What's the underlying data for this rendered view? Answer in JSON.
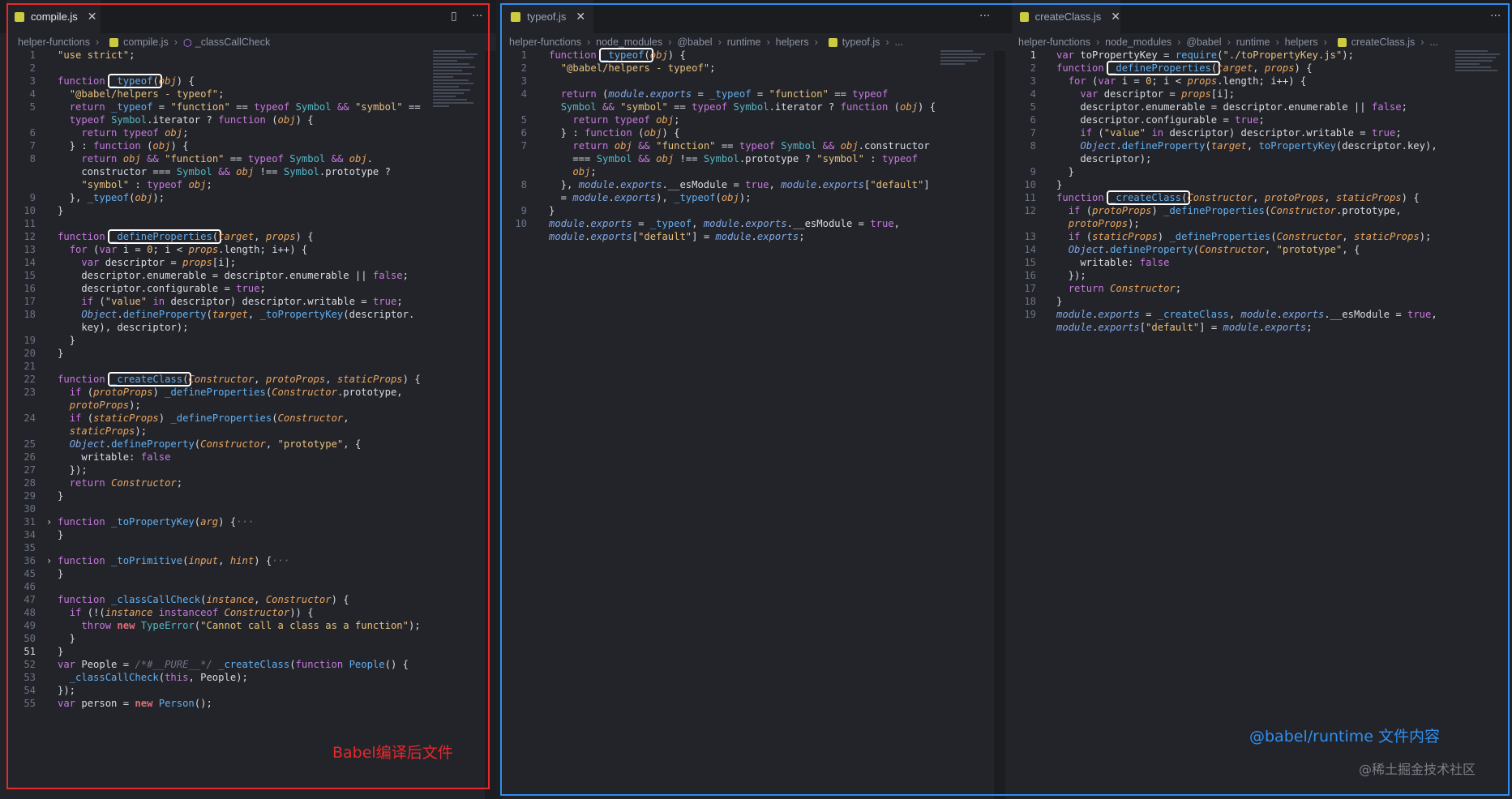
{
  "pane1": {
    "tab": "compile.js",
    "close": "✕",
    "split_icon": "▯",
    "more_icon": "···",
    "crumbs": [
      "helper-functions",
      "compile.js",
      "_classCallCheck"
    ],
    "lines": [
      {
        "n": "1",
        "h": "<span class=\"s\">\"use strict\"</span>;"
      },
      {
        "n": "2",
        "h": ""
      },
      {
        "n": "3",
        "h": "<span class=\"k\">function</span> <span class=\"hb\"><span class=\"f\">_typeof</span>(</span><span class=\"p\">obj</span>) {"
      },
      {
        "n": "4",
        "h": "  <span class=\"s\">\"@babel/helpers - typeof\"</span>;"
      },
      {
        "n": "5",
        "h": "  <span class=\"k\">return</span> <span class=\"f\">_typeof</span> = <span class=\"s\">\"function\"</span> == <span class=\"k\">typeof</span> <span class=\"ty\">Symbol</span> <span class=\"k\">&amp;&amp;</span> <span class=\"s\">\"symbol\"</span> =="
      },
      {
        "n": "",
        "h": "  <span class=\"k\">typeof</span> <span class=\"ty\">Symbol</span>.iterator ? <span class=\"k\">function</span> (<span class=\"p\">obj</span>) {"
      },
      {
        "n": "6",
        "h": "    <span class=\"k\">return typeof</span> <span class=\"p\">obj</span>;"
      },
      {
        "n": "7",
        "h": "  } : <span class=\"k\">function</span> (<span class=\"p\">obj</span>) {"
      },
      {
        "n": "8",
        "h": "    <span class=\"k\">return</span> <span class=\"p\">obj</span> <span class=\"k\">&amp;&amp;</span> <span class=\"s\">\"function\"</span> == <span class=\"k\">typeof</span> <span class=\"ty\">Symbol</span> <span class=\"k\">&amp;&amp;</span> <span class=\"p\">obj</span>."
      },
      {
        "n": "",
        "h": "    constructor === <span class=\"ty\">Symbol</span> <span class=\"k\">&amp;&amp;</span> <span class=\"p\">obj</span> !== <span class=\"ty\">Symbol</span>.prototype ?"
      },
      {
        "n": "",
        "h": "    <span class=\"s\">\"symbol\"</span> : <span class=\"k\">typeof</span> <span class=\"p\">obj</span>;"
      },
      {
        "n": "9",
        "h": "  }, <span class=\"f\">_typeof</span>(<span class=\"p\">obj</span>);"
      },
      {
        "n": "10",
        "h": "}"
      },
      {
        "n": "11",
        "h": ""
      },
      {
        "n": "12",
        "h": "<span class=\"k\">function</span> <span class=\"hb\"><span class=\"f\">_defineProperties</span>(</span><span class=\"p\">target</span>, <span class=\"p\">props</span>) {"
      },
      {
        "n": "13",
        "h": "  <span class=\"k\">for</span> (<span class=\"k\">var</span> i = <span class=\"s\">0</span>; i &lt; <span class=\"p\">props</span>.length; i++) {"
      },
      {
        "n": "14",
        "h": "    <span class=\"k\">var</span> descriptor = <span class=\"p\">props</span>[i];"
      },
      {
        "n": "15",
        "h": "    descriptor.enumerable = descriptor.enumerable || <span class=\"k\">false</span>;"
      },
      {
        "n": "16",
        "h": "    descriptor.configurable = <span class=\"k\">true</span>;"
      },
      {
        "n": "17",
        "h": "    <span class=\"k\">if</span> (<span class=\"s\">\"value\"</span> <span class=\"k\">in</span> descriptor) descriptor.writable = <span class=\"k\">true</span>;"
      },
      {
        "n": "18",
        "h": "    <span class=\"ob\">Object</span>.<span class=\"f\">defineProperty</span>(<span class=\"p\">target</span>, <span class=\"f\">_toPropertyKey</span>(descriptor."
      },
      {
        "n": "",
        "h": "    key), descriptor);"
      },
      {
        "n": "19",
        "h": "  }"
      },
      {
        "n": "20",
        "h": "}"
      },
      {
        "n": "21",
        "h": ""
      },
      {
        "n": "22",
        "h": "<span class=\"k\">function</span> <span class=\"hb\"><span class=\"f\">_createClass</span>(</span><span class=\"p\">Constructor</span>, <span class=\"p\">protoProps</span>, <span class=\"p\">staticProps</span>) {"
      },
      {
        "n": "23",
        "h": "  <span class=\"k\">if</span> (<span class=\"p\">protoProps</span>) <span class=\"f\">_defineProperties</span>(<span class=\"p\">Constructor</span>.prototype,"
      },
      {
        "n": "",
        "h": "  <span class=\"p\">protoProps</span>);"
      },
      {
        "n": "24",
        "h": "  <span class=\"k\">if</span> (<span class=\"p\">staticProps</span>) <span class=\"f\">_defineProperties</span>(<span class=\"p\">Constructor</span>,"
      },
      {
        "n": "",
        "h": "  <span class=\"p\">staticProps</span>);"
      },
      {
        "n": "25",
        "h": "  <span class=\"ob\">Object</span>.<span class=\"f\">defineProperty</span>(<span class=\"p\">Constructor</span>, <span class=\"s\">\"prototype\"</span>, {"
      },
      {
        "n": "26",
        "h": "    writable: <span class=\"k\">false</span>"
      },
      {
        "n": "27",
        "h": "  });"
      },
      {
        "n": "28",
        "h": "  <span class=\"k\">return</span> <span class=\"p\">Constructor</span>;"
      },
      {
        "n": "29",
        "h": "}"
      },
      {
        "n": "30",
        "h": ""
      },
      {
        "n": "31",
        "fold": true,
        "h": "<span class=\"k\">function</span> <span class=\"f\">_toPropertyKey</span>(<span class=\"p\">arg</span>) {<span class=\"c\">···</span>"
      },
      {
        "n": "34",
        "h": "}"
      },
      {
        "n": "35",
        "h": ""
      },
      {
        "n": "36",
        "fold": true,
        "h": "<span class=\"k\">function</span> <span class=\"f\">_toPrimitive</span>(<span class=\"p\">input</span>, <span class=\"p\">hint</span>) {<span class=\"c\">···</span>"
      },
      {
        "n": "45",
        "h": "}"
      },
      {
        "n": "46",
        "h": ""
      },
      {
        "n": "47",
        "h": "<span class=\"k\">function</span> <span class=\"f\">_classCallCheck</span>(<span class=\"p\">instance</span>, <span class=\"p\">Constructor</span>) {"
      },
      {
        "n": "48",
        "h": "  <span class=\"k\">if</span> (!(<span class=\"p\">instance</span> <span class=\"k\">instanceof</span> <span class=\"p\">Constructor</span>)) {"
      },
      {
        "n": "49",
        "h": "    <span class=\"k\">throw</span> <span class=\"nw\">new</span> <span class=\"ty\">TypeError</span>(<span class=\"s\">\"Cannot call a class as a function\"</span>);"
      },
      {
        "n": "50",
        "h": "  }"
      },
      {
        "n": "51",
        "cur": true,
        "h": "}"
      },
      {
        "n": "52",
        "h": "<span class=\"k\">var</span> People = <span class=\"c\">/*#__PURE__*/</span> <span class=\"f\">_createClass</span>(<span class=\"k\">function</span> <span class=\"f\">People</span>() {"
      },
      {
        "n": "53",
        "h": "  <span class=\"f\">_classCallCheck</span>(<span class=\"k\">this</span>, People);"
      },
      {
        "n": "54",
        "h": "});"
      },
      {
        "n": "55",
        "h": "<span class=\"k\">var</span> person = <span class=\"nw\">new</span> <span class=\"f\">Person</span>();"
      }
    ]
  },
  "pane2": {
    "tab": "typeof.js",
    "close": "✕",
    "more_icon": "···",
    "crumbs": [
      "helper-functions",
      "node_modules",
      "@babel",
      "runtime",
      "helpers",
      "typeof.js",
      "..."
    ],
    "lines": [
      {
        "n": "1",
        "h": "<span class=\"k\">function</span> <span class=\"hb\"><span class=\"f\">_typeof</span>(</span><span class=\"p\">obj</span>) {"
      },
      {
        "n": "2",
        "h": "  <span class=\"s\">\"@babel/helpers - typeof\"</span>;"
      },
      {
        "n": "3",
        "h": ""
      },
      {
        "n": "4",
        "h": "  <span class=\"k\">return</span> (<span class=\"ob\">module</span>.<span class=\"ob\">exports</span> = <span class=\"f\">_typeof</span> = <span class=\"s\">\"function\"</span> == <span class=\"k\">typeof</span>"
      },
      {
        "n": "",
        "h": "  <span class=\"ty\">Symbol</span> <span class=\"k\">&amp;&amp;</span> <span class=\"s\">\"symbol\"</span> == <span class=\"k\">typeof</span> <span class=\"ty\">Symbol</span>.iterator ? <span class=\"k\">function</span> (<span class=\"p\">obj</span>) {"
      },
      {
        "n": "5",
        "h": "    <span class=\"k\">return typeof</span> <span class=\"p\">obj</span>;"
      },
      {
        "n": "6",
        "h": "  } : <span class=\"k\">function</span> (<span class=\"p\">obj</span>) {"
      },
      {
        "n": "7",
        "h": "    <span class=\"k\">return</span> <span class=\"p\">obj</span> <span class=\"k\">&amp;&amp;</span> <span class=\"s\">\"function\"</span> == <span class=\"k\">typeof</span> <span class=\"ty\">Symbol</span> <span class=\"k\">&amp;&amp;</span> <span class=\"p\">obj</span>.constructor"
      },
      {
        "n": "",
        "h": "    === <span class=\"ty\">Symbol</span> <span class=\"k\">&amp;&amp;</span> <span class=\"p\">obj</span> !== <span class=\"ty\">Symbol</span>.prototype ? <span class=\"s\">\"symbol\"</span> : <span class=\"k\">typeof</span>"
      },
      {
        "n": "",
        "h": "    <span class=\"p\">obj</span>;"
      },
      {
        "n": "8",
        "h": "  }, <span class=\"ob\">module</span>.<span class=\"ob\">exports</span>.__esModule = <span class=\"k\">true</span>, <span class=\"ob\">module</span>.<span class=\"ob\">exports</span>[<span class=\"s\">\"default\"</span>]"
      },
      {
        "n": "",
        "h": "  = <span class=\"ob\">module</span>.<span class=\"ob\">exports</span>), <span class=\"f\">_typeof</span>(<span class=\"p\">obj</span>);"
      },
      {
        "n": "9",
        "h": "}"
      },
      {
        "n": "10",
        "h": "<span class=\"ob\">module</span>.<span class=\"ob\">exports</span> = <span class=\"f\">_typeof</span>, <span class=\"ob\">module</span>.<span class=\"ob\">exports</span>.__esModule = <span class=\"k\">true</span>,"
      },
      {
        "n": "",
        "h": "<span class=\"ob\">module</span>.<span class=\"ob\">exports</span>[<span class=\"s\">\"default\"</span>] = <span class=\"ob\">module</span>.<span class=\"ob\">exports</span>;"
      }
    ]
  },
  "pane3": {
    "tab": "createClass.js",
    "close": "✕",
    "more_icon": "···",
    "crumbs": [
      "helper-functions",
      "node_modules",
      "@babel",
      "runtime",
      "helpers",
      "createClass.js",
      "..."
    ],
    "lines": [
      {
        "n": "1",
        "cur": true,
        "h": "<span class=\"k\">var</span> toPropertyKey = <span class=\"f\">require</span>(<span class=\"s\">\"./toPropertyKey.js\"</span>);"
      },
      {
        "n": "2",
        "h": "<span class=\"k\">function</span> <span class=\"hb\"><span class=\"f\">_defineProperties</span>(</span><span class=\"p\">target</span>, <span class=\"p\">props</span>) {"
      },
      {
        "n": "3",
        "h": "  <span class=\"k\">for</span> (<span class=\"k\">var</span> i = <span class=\"s\">0</span>; i &lt; <span class=\"p\">props</span>.length; i++) {"
      },
      {
        "n": "4",
        "h": "    <span class=\"k\">var</span> descriptor = <span class=\"p\">props</span>[i];"
      },
      {
        "n": "5",
        "h": "    descriptor.enumerable = descriptor.enumerable || <span class=\"k\">false</span>;"
      },
      {
        "n": "6",
        "h": "    descriptor.configurable = <span class=\"k\">true</span>;"
      },
      {
        "n": "7",
        "h": "    <span class=\"k\">if</span> (<span class=\"s\">\"value\"</span> <span class=\"k\">in</span> descriptor) descriptor.writable = <span class=\"k\">true</span>;"
      },
      {
        "n": "8",
        "h": "    <span class=\"ob\">Object</span>.<span class=\"f\">defineProperty</span>(<span class=\"p\">target</span>, <span class=\"f\">toPropertyKey</span>(descriptor.key),"
      },
      {
        "n": "",
        "h": "    descriptor);"
      },
      {
        "n": "9",
        "h": "  }"
      },
      {
        "n": "10",
        "h": "}"
      },
      {
        "n": "11",
        "h": "<span class=\"k\">function</span> <span class=\"hb\"><span class=\"f\">_createClass</span>(</span><span class=\"p\">Constructor</span>, <span class=\"p\">protoProps</span>, <span class=\"p\">staticProps</span>) {"
      },
      {
        "n": "12",
        "h": "  <span class=\"k\">if</span> (<span class=\"p\">protoProps</span>) <span class=\"f\">_defineProperties</span>(<span class=\"p\">Constructor</span>.prototype,"
      },
      {
        "n": "",
        "h": "  <span class=\"p\">protoProps</span>);"
      },
      {
        "n": "13",
        "h": "  <span class=\"k\">if</span> (<span class=\"p\">staticProps</span>) <span class=\"f\">_defineProperties</span>(<span class=\"p\">Constructor</span>, <span class=\"p\">staticProps</span>);"
      },
      {
        "n": "14",
        "h": "  <span class=\"ob\">Object</span>.<span class=\"f\">defineProperty</span>(<span class=\"p\">Constructor</span>, <span class=\"s\">\"prototype\"</span>, {"
      },
      {
        "n": "15",
        "h": "    writable: <span class=\"k\">false</span>"
      },
      {
        "n": "16",
        "h": "  });"
      },
      {
        "n": "17",
        "h": "  <span class=\"k\">return</span> <span class=\"p\">Constructor</span>;"
      },
      {
        "n": "18",
        "h": "}"
      },
      {
        "n": "19",
        "h": "<span class=\"ob\">module</span>.<span class=\"ob\">exports</span> = <span class=\"f\">_createClass</span>, <span class=\"ob\">module</span>.<span class=\"ob\">exports</span>.__esModule = <span class=\"k\">true</span>,"
      },
      {
        "n": "",
        "h": "<span class=\"ob\">module</span>.<span class=\"ob\">exports</span>[<span class=\"s\">\"default\"</span>] = <span class=\"ob\">module</span>.<span class=\"ob\">exports</span>;"
      }
    ]
  },
  "annotations": {
    "left_label": "Babel编译后文件",
    "right_label": "@babel/runtime 文件内容",
    "watermark": "@稀土掘金技术社区"
  },
  "colors": {
    "red_frame": "#e8282b",
    "blue_frame": "#2f8ff0",
    "highlight_box": "#ffffff",
    "editor_bg": "#23242a"
  }
}
